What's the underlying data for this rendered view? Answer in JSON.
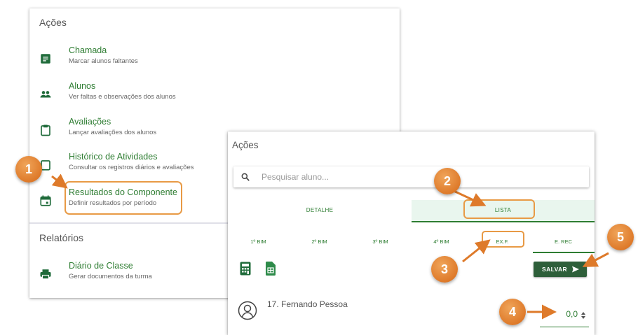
{
  "left_panel": {
    "actions_title": "Ações",
    "items": [
      {
        "label": "Chamada",
        "sub": "Marcar alunos faltantes",
        "icon": "list-alt-icon"
      },
      {
        "label": "Alunos",
        "sub": "Ver faltas e observações dos alunos",
        "icon": "people-icon"
      },
      {
        "label": "Avaliações",
        "sub": "Lançar avaliações dos alunos",
        "icon": "clipboard-icon"
      },
      {
        "label": "Histórico de Atividades",
        "sub": "Consultar os registros diários e avaliações",
        "icon": "history-icon"
      },
      {
        "label": "Resultados do Componente",
        "sub": "Definir resultados por período",
        "icon": "calendar-icon"
      }
    ],
    "reports_title": "Relatórios",
    "reports": [
      {
        "label": "Diário de Classe",
        "sub": "Gerar documentos da turma",
        "icon": "printer-icon"
      }
    ]
  },
  "right_panel": {
    "title": "Ações",
    "search": {
      "placeholder": "Pesquisar aluno...",
      "value": ""
    },
    "tabs": [
      {
        "label": "DETALHE",
        "active": false
      },
      {
        "label": "LISTA",
        "active": true
      }
    ],
    "periods": [
      {
        "label": "1º BIM",
        "active": false
      },
      {
        "label": "2º BIM",
        "active": false
      },
      {
        "label": "3º BIM",
        "active": false
      },
      {
        "label": "4º BIM",
        "active": false
      },
      {
        "label": "EX.F.",
        "active": false
      },
      {
        "label": "E. REC",
        "active": true
      }
    ],
    "save_label": "SALVAR",
    "student": {
      "name": "17. Fernando Pessoa",
      "grade": "0,0"
    }
  },
  "markers": [
    "1",
    "2",
    "3",
    "4",
    "5"
  ],
  "colors": {
    "primary_green": "#2e7d32",
    "dark_green": "#2e5f3a",
    "highlight_orange": "#e89a45",
    "marker_orange": "#de7a2a",
    "tab_active_bg": "#e9f6ee"
  }
}
